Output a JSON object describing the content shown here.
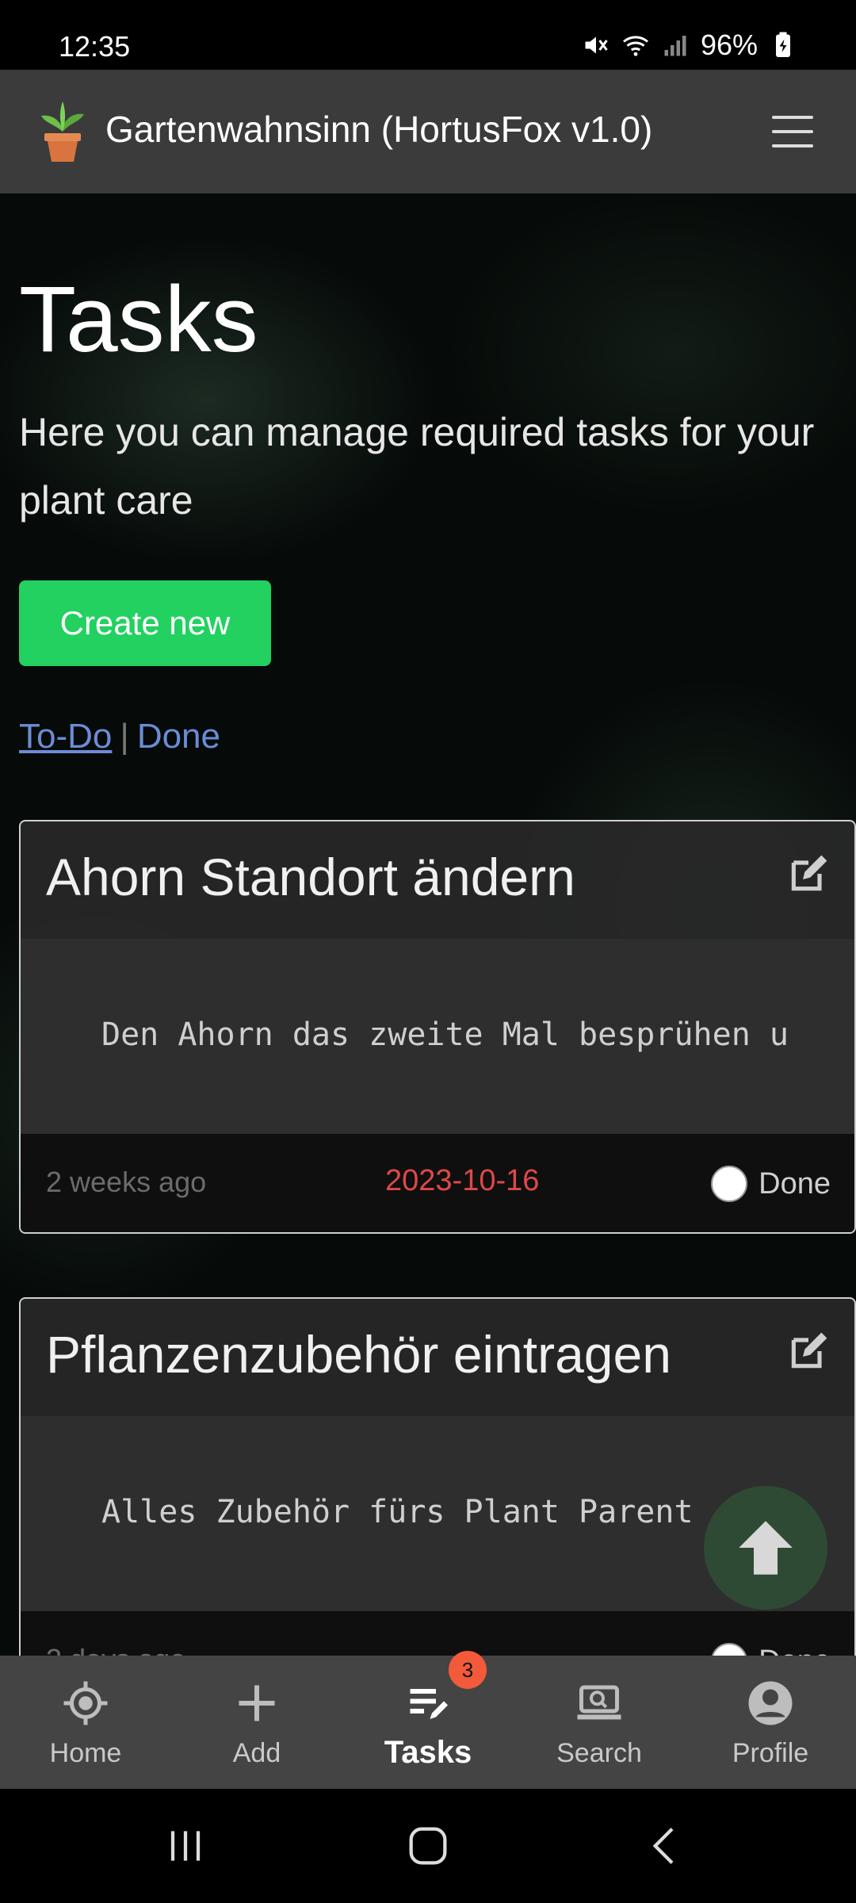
{
  "status_bar": {
    "time": "12:35",
    "battery": "96%",
    "icons": [
      "mute-icon",
      "wifi-icon",
      "signal-icon",
      "battery-icon"
    ]
  },
  "app_bar": {
    "title": "Gartenwahnsinn (HortusFox v1.0)",
    "logo_icon": "potted-plant-icon",
    "menu_icon": "hamburger-icon"
  },
  "page": {
    "title": "Tasks",
    "subtitle": "Here you can manage required tasks for your plant care",
    "create_button": "Create new",
    "filters": {
      "todo": "To-Do",
      "separator": "|",
      "done": "Done"
    }
  },
  "tasks": [
    {
      "title": "Ahorn Standort ändern",
      "description": "Den Ahorn das zweite Mal besprühen u",
      "age": "2 weeks ago",
      "due": "2023-10-16",
      "done_label": "Done"
    },
    {
      "title": "Pflanzenzubehör eintragen",
      "description": "Alles Zubehör fürs Plant Parent",
      "age": "2 days ago",
      "due": "",
      "done_label": "Done"
    }
  ],
  "bottom_nav": [
    {
      "label": "Home",
      "icon": "home-icon"
    },
    {
      "label": "Add",
      "icon": "plus-icon"
    },
    {
      "label": "Tasks",
      "icon": "tasks-icon",
      "badge": "3"
    },
    {
      "label": "Search",
      "icon": "search-icon"
    },
    {
      "label": "Profile",
      "icon": "profile-icon"
    }
  ],
  "colors": {
    "accent_green": "#22d160",
    "link_blue": "#6b8cd6",
    "due_red": "#e04848",
    "badge": "#f25a3a"
  }
}
